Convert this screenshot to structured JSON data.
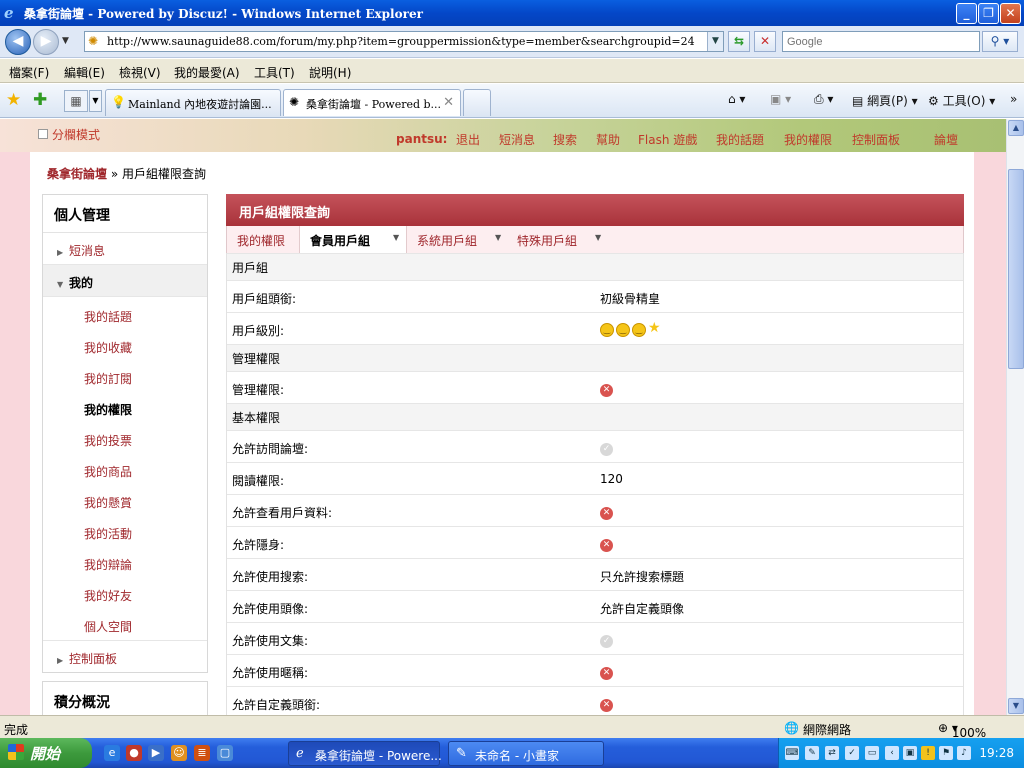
{
  "window": {
    "title": "桑拿街論壇 - Powered by Discuz! - Windows Internet Explorer",
    "minimize_glyph": "_",
    "restore_glyph": "❐",
    "close_glyph": "✕"
  },
  "address_bar": {
    "url": "http://www.saunaguide88.com/forum/my.php?item=grouppermission&type=member&searchgroupid=24",
    "search_placeholder": "Google"
  },
  "menu": [
    "檔案(F)",
    "編輯(E)",
    "檢視(V)",
    "我的最愛(A)",
    "工具(T)",
    "說明(H)"
  ],
  "tabs": [
    {
      "label": "Mainland 內地夜遊討論園...",
      "active": false
    },
    {
      "label": "桑拿街論壇 - Powered b...",
      "active": true
    }
  ],
  "commands": {
    "page": "網頁(P)",
    "tools": "工具(O)"
  },
  "banner": {
    "split_mode": "分欄模式",
    "username": "pantsu:",
    "nav": [
      "退出",
      "短消息",
      "搜索",
      "幫助",
      "Flash 遊戲",
      "我的話題",
      "我的權限",
      "控制面板",
      "論壇"
    ]
  },
  "breadcrumb": {
    "home": "桑拿街論壇",
    "separator": " » ",
    "current": "用戶組權限查詢"
  },
  "sidebar": {
    "title": "個人管理",
    "cat_messages": "短消息",
    "cat_my": "我的",
    "sub_items": [
      "我的話題",
      "我的收藏",
      "我的訂閱",
      "我的權限",
      "我的投票",
      "我的商品",
      "我的懸賞",
      "我的活動",
      "我的辯論",
      "我的好友",
      "個人空間"
    ],
    "current_item": "我的權限",
    "cat_control": "控制面板",
    "box2_title": "積分概況"
  },
  "panel": {
    "title": "用戶組權限查詢",
    "subtabs": [
      "我的權限",
      "會員用戶組",
      "系統用戶組",
      "特殊用戶組"
    ],
    "active_subtab": "會員用戶組",
    "rows": [
      {
        "type": "section",
        "label": "用戶組"
      },
      {
        "type": "row",
        "label": "用戶組頭銜:",
        "value": "初級骨精皇"
      },
      {
        "type": "row",
        "label": "用戶級別:",
        "value_icon": "level-stars"
      },
      {
        "type": "section",
        "label": "管理權限"
      },
      {
        "type": "row",
        "label": "管理權限:",
        "value_icon": "no"
      },
      {
        "type": "section",
        "label": "基本權限"
      },
      {
        "type": "row",
        "label": "允許訪問論壇:",
        "value_icon": "yes"
      },
      {
        "type": "row",
        "label": "閱讀權限:",
        "value": "120"
      },
      {
        "type": "row",
        "label": "允許查看用戶資料:",
        "value_icon": "no"
      },
      {
        "type": "row",
        "label": "允許隱身:",
        "value_icon": "no"
      },
      {
        "type": "row",
        "label": "允許使用搜索:",
        "value": "只允許搜索標題"
      },
      {
        "type": "row",
        "label": "允許使用頭像:",
        "value": "允許自定義頭像"
      },
      {
        "type": "row",
        "label": "允許使用文集:",
        "value_icon": "yes"
      },
      {
        "type": "row",
        "label": "允許使用暱稱:",
        "value_icon": "no"
      },
      {
        "type": "row",
        "label": "允許自定義頭銜:",
        "value_icon": "no"
      }
    ]
  },
  "status_bar": {
    "status": "完成",
    "zone": "網際網路",
    "zoom": "100%"
  },
  "taskbar": {
    "start": "開始",
    "tasks": [
      {
        "label": "桑拿街論壇 - Powere...",
        "active": true
      },
      {
        "label": "未命名 - 小畫家",
        "active": false
      }
    ],
    "clock": "19:28"
  },
  "colors": {
    "accent": "#a8323a",
    "link": "#a0282d",
    "page_bg": "#f9d7dc"
  }
}
